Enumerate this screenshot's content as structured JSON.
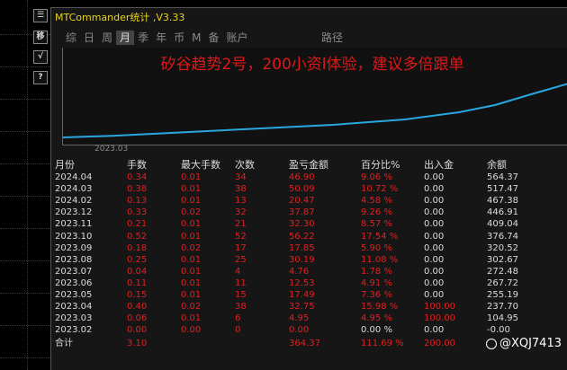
{
  "window": {
    "title": "MTCommander统计 ,V3.33"
  },
  "left_toolbar": [
    {
      "label": "☰",
      "icon": "menu-icon"
    },
    {
      "label": "移",
      "icon": "move-icon"
    },
    {
      "label": "√",
      "icon": "check-icon"
    },
    {
      "label": "?",
      "icon": "help-icon"
    }
  ],
  "tabs": [
    "综",
    "日",
    "周",
    "月",
    "季",
    "年",
    "币",
    "M",
    "备",
    "账户"
  ],
  "active_tab": "月",
  "path_label": "路径",
  "chart": {
    "overlay_text": "矽谷趋势2号，200小资l体验，建议多倍跟单",
    "x_start_label": "2023.03"
  },
  "table": {
    "headers": [
      "月份",
      "手数",
      "最大手数",
      "次数",
      "盈亏金额",
      "百分比%",
      "出入金",
      "余额"
    ],
    "rows": [
      [
        "2024.04",
        "0.34",
        "0.01",
        "34",
        "46.90",
        "9.06 %",
        "0.00",
        "564.37"
      ],
      [
        "2024.03",
        "0.38",
        "0.01",
        "38",
        "50.09",
        "10.72 %",
        "0.00",
        "517.47"
      ],
      [
        "2024.02",
        "0.13",
        "0.01",
        "13",
        "20.47",
        "4.58 %",
        "0.00",
        "467.38"
      ],
      [
        "2023.12",
        "0.33",
        "0.02",
        "32",
        "37.87",
        "9.26 %",
        "0.00",
        "446.91"
      ],
      [
        "2023.11",
        "0.21",
        "0.01",
        "21",
        "32.30",
        "8.57 %",
        "0.00",
        "409.04"
      ],
      [
        "2023.10",
        "0.52",
        "0.01",
        "52",
        "56.22",
        "17.54 %",
        "0.00",
        "376.74"
      ],
      [
        "2023.09",
        "0.18",
        "0.02",
        "17",
        "17.85",
        "5.90 %",
        "0.00",
        "320.52"
      ],
      [
        "2023.08",
        "0.25",
        "0.01",
        "25",
        "30.19",
        "11.08 %",
        "0.00",
        "302.67"
      ],
      [
        "2023.07",
        "0.04",
        "0.01",
        "4",
        "4.76",
        "1.78 %",
        "0.00",
        "272.48"
      ],
      [
        "2023.06",
        "0.11",
        "0.01",
        "11",
        "12.53",
        "4.91 %",
        "0.00",
        "267.72"
      ],
      [
        "2023.05",
        "0.15",
        "0.01",
        "15",
        "17.49",
        "7.36 %",
        "0.00",
        "255.19"
      ],
      [
        "2023.04",
        "0.40",
        "0.02",
        "38",
        "32.75",
        "15.98 %",
        "100.00",
        "237.70"
      ],
      [
        "2023.03",
        "0.06",
        "0.01",
        "6",
        "4.95",
        "4.95 %",
        "100.00",
        "104.95"
      ],
      [
        "2023.02",
        "0.00",
        "0.00",
        "0",
        "0.00",
        "0.00 %",
        "0.00",
        "-0.00"
      ]
    ],
    "total": [
      "合计",
      "3.10",
      "",
      "",
      "364.37",
      "111.69 %",
      "200.00",
      ""
    ]
  },
  "credit": "@XQJ7413",
  "colors": {
    "title": "#e8d41a",
    "value_red": "#e02020",
    "line": "#2aa7e0",
    "overlay": "#e01818"
  }
}
